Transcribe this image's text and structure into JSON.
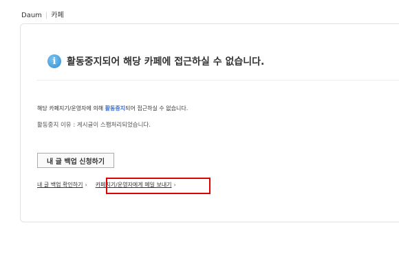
{
  "breadcrumb": {
    "site": "Daum",
    "section": "카페"
  },
  "notice": {
    "title": "활동중지되어 해당 카페에 접근하실 수 없습니다.",
    "reason_prefix": "해당 카페지기/운영자에 의해 ",
    "reason_highlight": "활동중지",
    "reason_suffix": "되어 접근하실 수 없습니다.",
    "reason_detail": "활동중지 이유 : 게시글이 스팸처리되었습니다."
  },
  "actions": {
    "backup_button": "내 글 백업 신청하기",
    "check_backup_link": "내 글 백업 확인하기",
    "mail_link": "카페지기/운영자에게 메일 보내기",
    "arrow": "›"
  },
  "colors": {
    "highlight": "#3b6fd6",
    "annotation_box": "#e00000"
  }
}
